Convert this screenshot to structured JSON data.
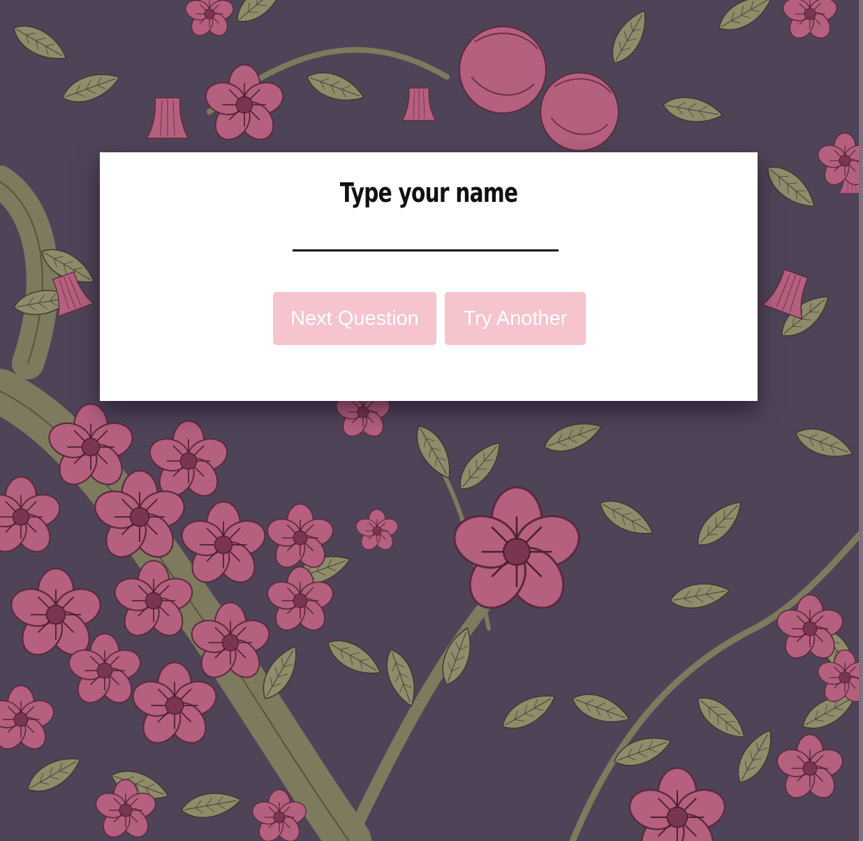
{
  "dialog": {
    "title": "Type your name",
    "name_input": {
      "value": "",
      "placeholder": ""
    },
    "buttons": {
      "next_label": "Next Question",
      "try_label": "Try Another"
    }
  },
  "colors": {
    "background": "#4f4358",
    "petal": "#b5607f",
    "leaf": "#8f8c6c",
    "button": "#f5c4cd"
  },
  "background_icon": "floral-wallpaper"
}
